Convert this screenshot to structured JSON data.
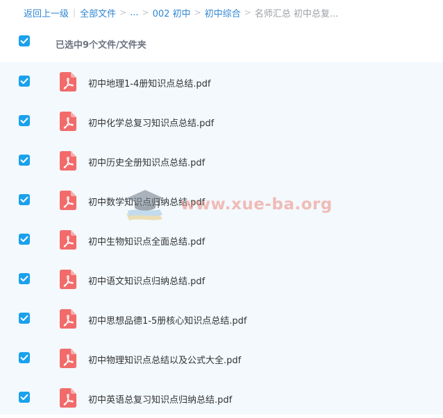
{
  "breadcrumb": {
    "back": "返回上一级",
    "all_files": "全部文件",
    "ellipsis": "...",
    "level1": "002 初中",
    "level2": "初中综合",
    "current": "名师汇总 初中总复..."
  },
  "header": {
    "selected_text": "已选中9个文件/文件夹"
  },
  "files": [
    {
      "name": "初中地理1-4册知识点总结.pdf"
    },
    {
      "name": "初中化学总复习知识点总结.pdf"
    },
    {
      "name": "初中历史全册知识点总结.pdf"
    },
    {
      "name": "初中数学知识点归纳总结.pdf"
    },
    {
      "name": "初中生物知识点全面总结.pdf"
    },
    {
      "name": "初中语文知识点归纳总结.pdf"
    },
    {
      "name": "初中思想品德1-5册核心知识点总结.pdf"
    },
    {
      "name": "初中物理知识点总结以及公式大全.pdf"
    },
    {
      "name": "初中英语总复习知识点归纳总结.pdf"
    }
  ],
  "watermark": {
    "text": "www.xue-ba.org",
    "icon": "graduation-cap-book-icon"
  },
  "icons": {
    "checkbox": "checkmark-icon",
    "file": "pdf-file-icon"
  },
  "colors": {
    "link": "#2f86d4",
    "checkbox": "#1aa1ed",
    "pdf_icon": "#f26b6b",
    "list_background": "#f3f9fd",
    "watermark": "#ee8a7e"
  }
}
